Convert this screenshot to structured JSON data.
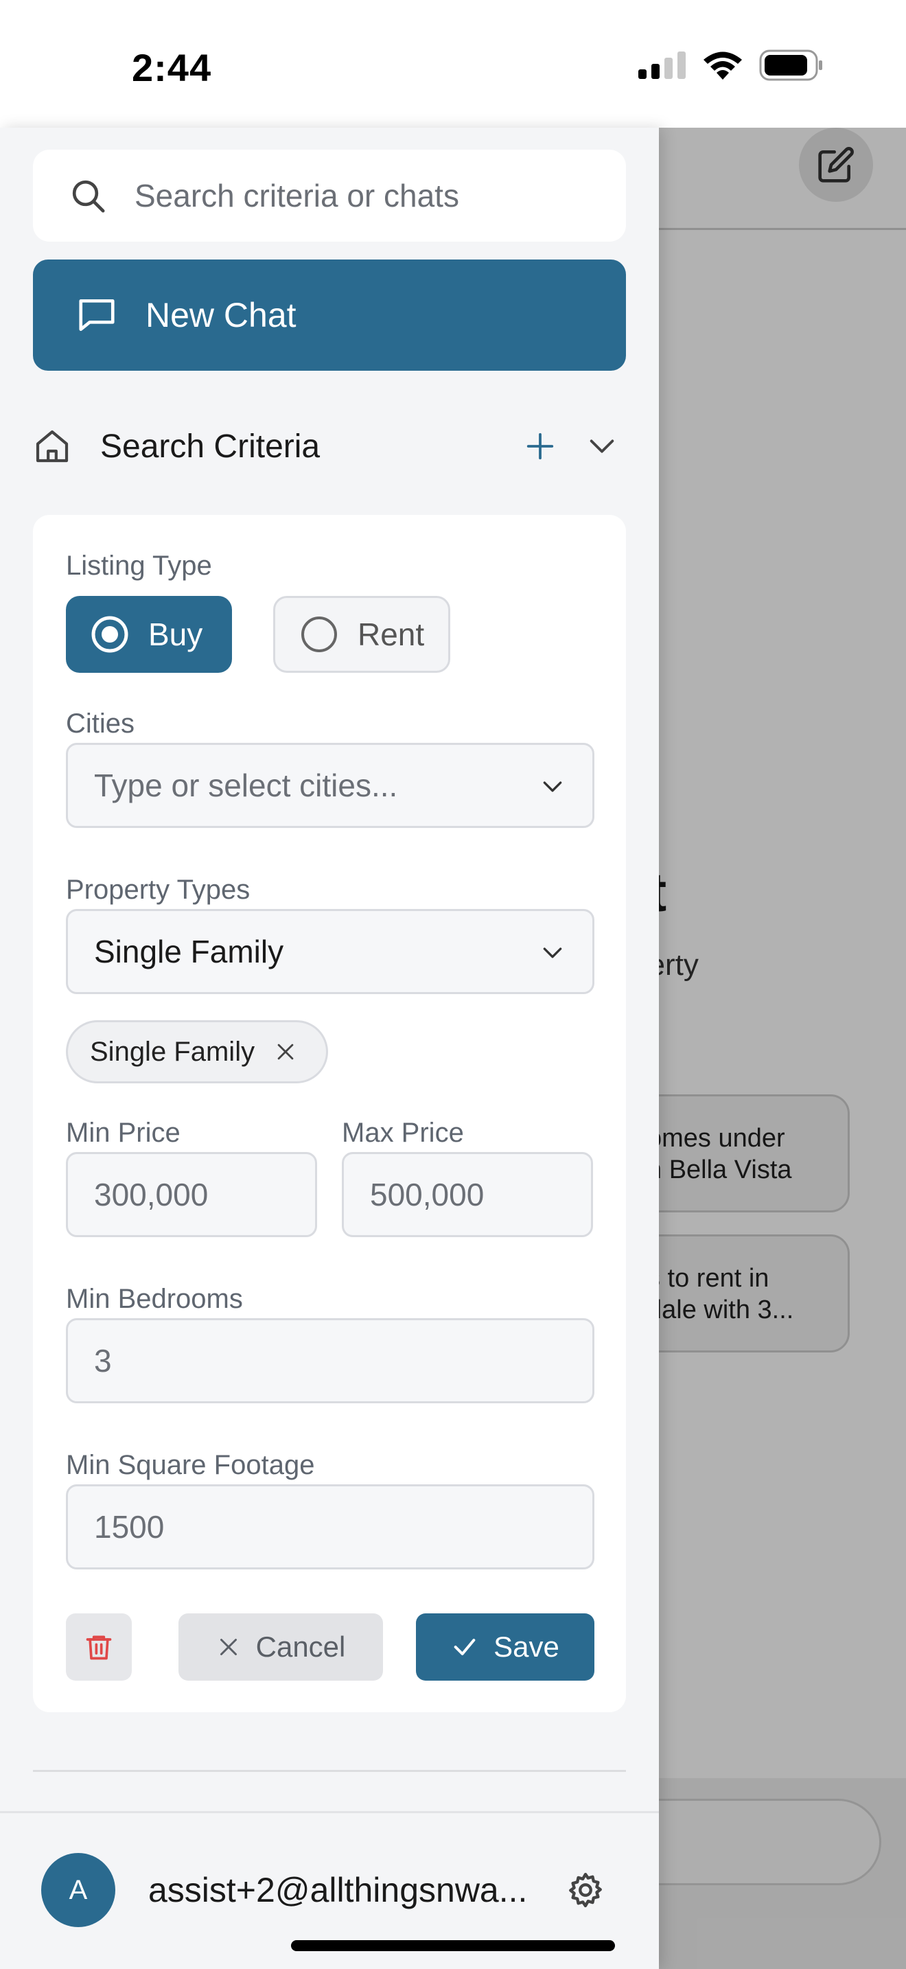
{
  "status_bar": {
    "time": "2:44"
  },
  "background": {
    "title_fragment": "at",
    "subtitle_lines": [
      "perty",
      "?"
    ],
    "suggestions": [
      {
        "line1": "omes under",
        "line2": "n Bella Vista"
      },
      {
        "line1": "s to rent in",
        "line2": "dale with 3..."
      }
    ],
    "compose_icon": "edit-icon"
  },
  "drawer": {
    "search": {
      "placeholder": "Search criteria or chats",
      "icon": "search-icon"
    },
    "new_chat": {
      "label": "New Chat",
      "icon": "chat-bubble-icon"
    },
    "section": {
      "title": "Search Criteria",
      "icon": "home-icon",
      "add_icon": "plus-icon",
      "collapse_icon": "chevron-down-icon"
    },
    "form": {
      "listing_type": {
        "label": "Listing Type",
        "options": [
          {
            "label": "Buy",
            "selected": true
          },
          {
            "label": "Rent",
            "selected": false
          }
        ]
      },
      "cities": {
        "label": "Cities",
        "placeholder": "Type or select cities..."
      },
      "property_types": {
        "label": "Property Types",
        "value": "Single Family",
        "chips": [
          "Single Family"
        ]
      },
      "min_price": {
        "label": "Min Price",
        "value": "300,000"
      },
      "max_price": {
        "label": "Max Price",
        "value": "500,000"
      },
      "min_bedrooms": {
        "label": "Min Bedrooms",
        "value": "3"
      },
      "min_sqft": {
        "label": "Min Square Footage",
        "value": "1500"
      },
      "actions": {
        "cancel": "Cancel",
        "save": "Save",
        "delete_icon": "trash-icon"
      }
    },
    "user": {
      "initial": "A",
      "email": "assist+2@allthingsnwa...",
      "settings_icon": "gear-icon"
    }
  },
  "colors": {
    "accent": "#2a6a8f",
    "danger": "#e04848"
  }
}
